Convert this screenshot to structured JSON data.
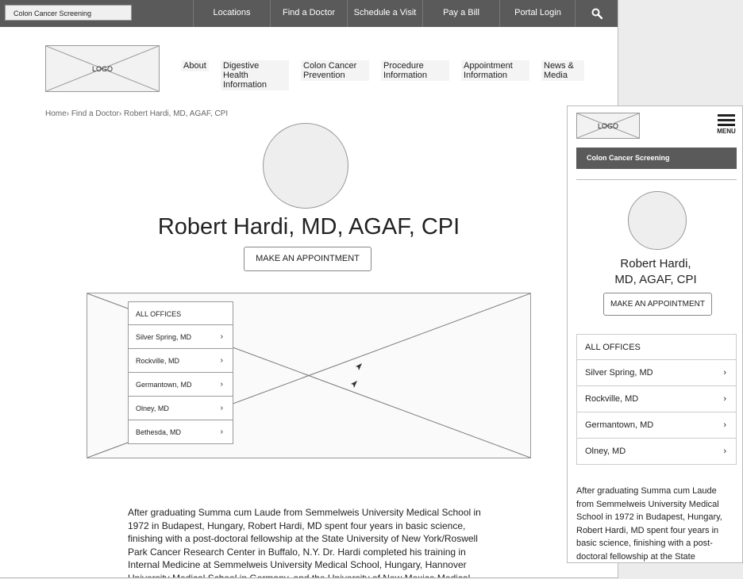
{
  "desktop": {
    "site_select": "Colon Cancer Screening",
    "top_links": [
      "Locations",
      "Find a Doctor",
      "Schedule a Visit",
      "Pay a Bill",
      "Portal Login"
    ],
    "logo": "LOGO",
    "nav": [
      {
        "line1": "About",
        "line2": ""
      },
      {
        "line1": "Digestive Health",
        "line2": "Information"
      },
      {
        "line1": "Colon Cancer",
        "line2": "Prevention"
      },
      {
        "line1": "Procedure",
        "line2": "Information"
      },
      {
        "line1": "Appointment",
        "line2": "Information"
      },
      {
        "line1": "News &",
        "line2": "Media"
      }
    ],
    "breadcrumb": {
      "home": "Home",
      "find": "Find a Doctor",
      "current": "Robert Hardi, MD, AGAF, CPI"
    },
    "doctor_name": "Robert Hardi, MD, AGAF, CPI",
    "appointment_label": "MAKE AN APPOINTMENT",
    "offices_header": "ALL OFFICES",
    "offices": [
      "Silver Spring, MD",
      "Rockville, MD",
      "Germantown, MD",
      "Olney, MD",
      "Bethesda, MD"
    ],
    "bio": "After graduating Summa cum Laude from Semmelweis University Medical School in 1972 in Budapest, Hungary, Robert Hardi, MD spent four years in basic science, finishing with a post-doctoral fellowship at the State University of New York/Roswell Park Cancer Research Center in Buffalo, N.Y. Dr. Hardi completed his training in Internal Medicine at Semmelweis University Medical School, Hungary, Hannover University Medical School in Germany, and the University of New Mexico Medical"
  },
  "mobile": {
    "logo": "LOGO",
    "menu_label": "MENU",
    "site_band": "Colon Cancer Screening",
    "name_line1": "Robert Hardi,",
    "name_line2": "MD, AGAF, CPI",
    "appointment_label": "MAKE AN APPOINTMENT",
    "offices_header": "ALL OFFICES",
    "offices": [
      "Silver Spring, MD",
      "Rockville, MD",
      "Germantown, MD",
      "Olney, MD"
    ],
    "bio": "After graduating Summa cum Laude from Semmelweis University Medical School in 1972 in Budapest, Hungary, Robert Hardi, MD spent four years in basic science, finishing with a post-doctoral fellowship at the State"
  },
  "icons": {
    "search": "search-icon",
    "menu": "hamburger-icon",
    "chevron": "chevron-right-icon",
    "map_markers": "map-marker-icon"
  },
  "colors": {
    "topbar": "#5a5a5a",
    "band": "#5a5a5a",
    "text": "#222222",
    "border": "#999999"
  }
}
